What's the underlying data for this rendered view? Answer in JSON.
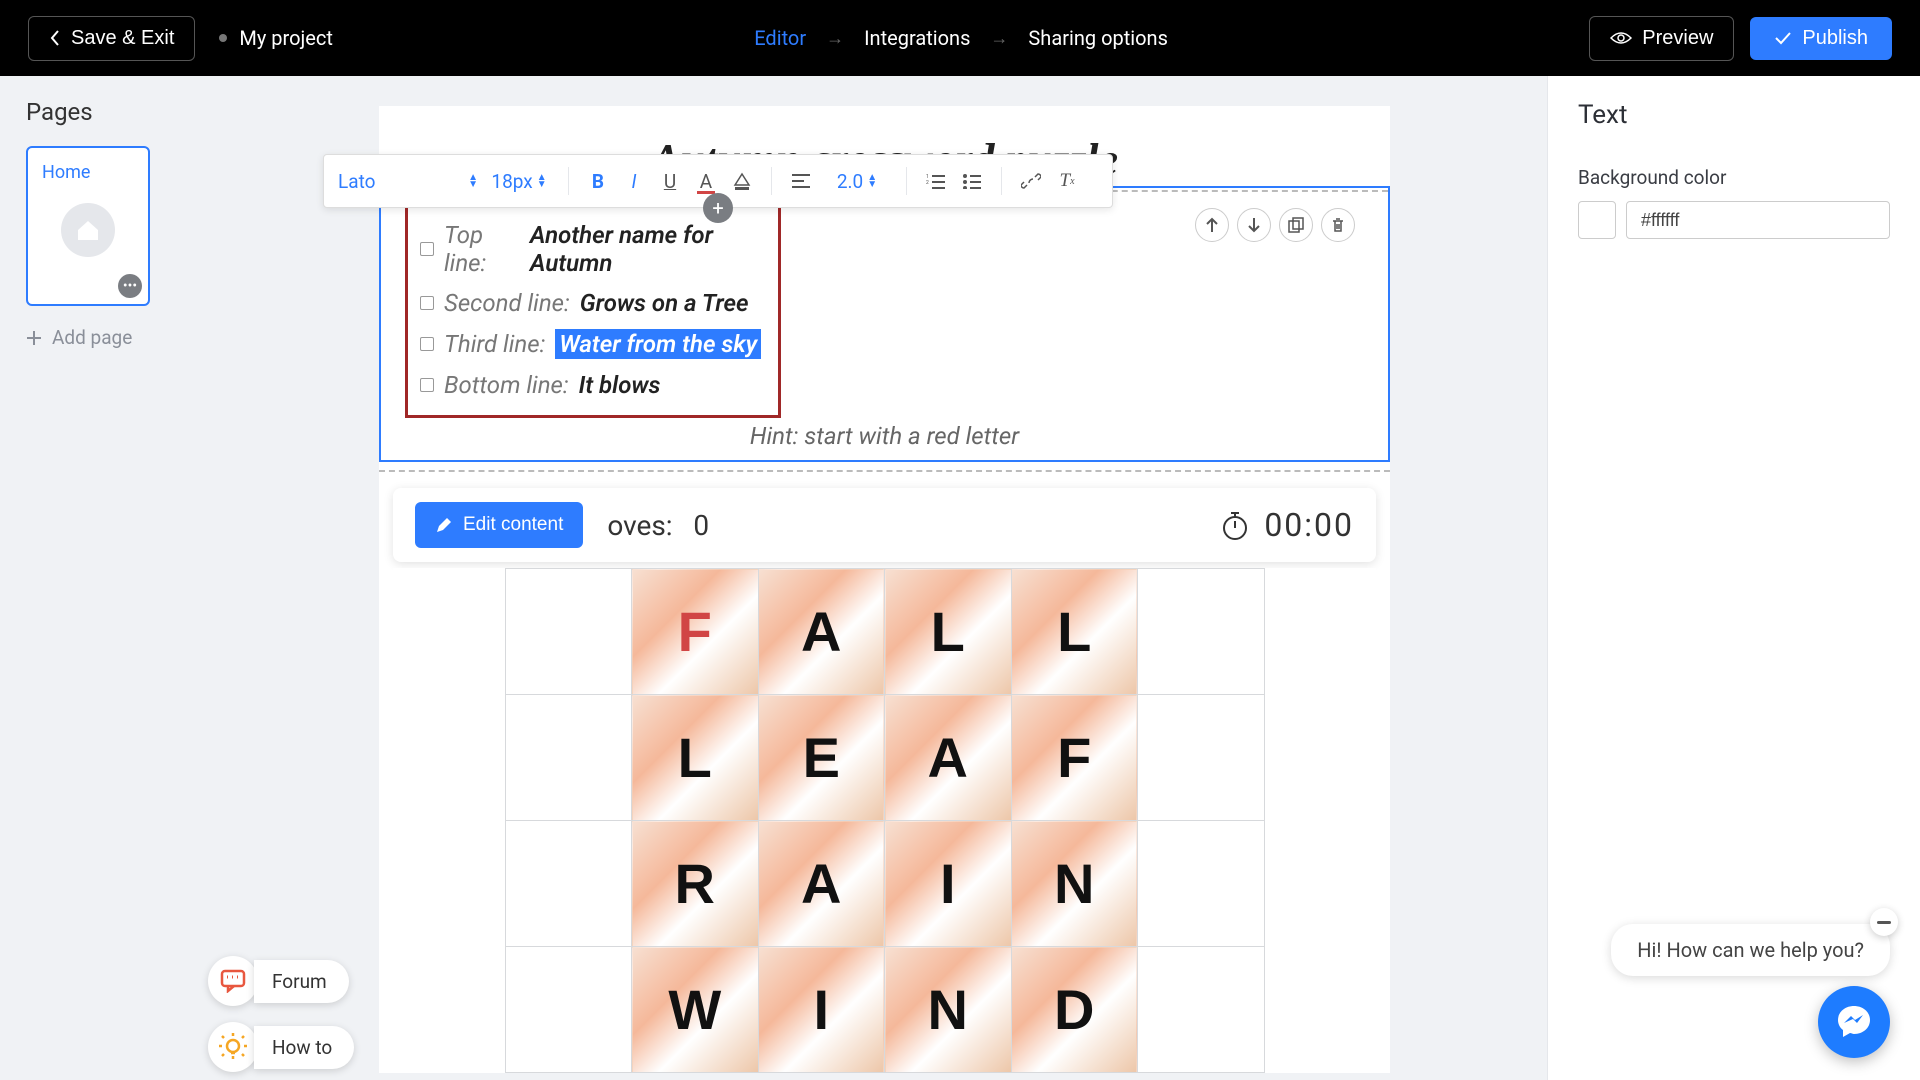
{
  "topbar": {
    "save_exit": "Save & Exit",
    "project_name": "My project",
    "nav": {
      "editor": "Editor",
      "integrations": "Integrations",
      "sharing": "Sharing options"
    },
    "preview": "Preview",
    "publish": "Publish"
  },
  "sidebar": {
    "title": "Pages",
    "pages": [
      {
        "label": "Home"
      }
    ],
    "add_page": "Add page"
  },
  "toolbar": {
    "font": "Lato",
    "size": "18px",
    "line_height": "2.0"
  },
  "textblock": {
    "page_title": "Autumn crossword puzzle",
    "clues": [
      {
        "label": "Top line:",
        "value": "Another name for Autumn",
        "highlight": false
      },
      {
        "label": "Second line:",
        "value": "Grows on a Tree",
        "highlight": false
      },
      {
        "label": "Third line:",
        "value": "Water from the sky",
        "highlight": true
      },
      {
        "label": "Bottom line:",
        "value": "It blows",
        "highlight": false
      }
    ],
    "hint": "Hint: start with a red letter"
  },
  "widget": {
    "edit": "Edit content",
    "moves_label": "oves:",
    "moves_value": "0",
    "timer": "00:00",
    "grid": [
      [
        "F",
        "A",
        "L",
        "L"
      ],
      [
        "L",
        "E",
        "A",
        "F"
      ],
      [
        "R",
        "A",
        "I",
        "N"
      ],
      [
        "W",
        "I",
        "N",
        "D"
      ]
    ],
    "red_letters": [
      [
        0,
        0
      ]
    ]
  },
  "panel": {
    "title": "Text",
    "bg_label": "Background color",
    "bg_value": "#ffffff"
  },
  "helpers": {
    "forum": "Forum",
    "howto": "How to"
  },
  "chat": {
    "message": "Hi! How can we help you?"
  }
}
